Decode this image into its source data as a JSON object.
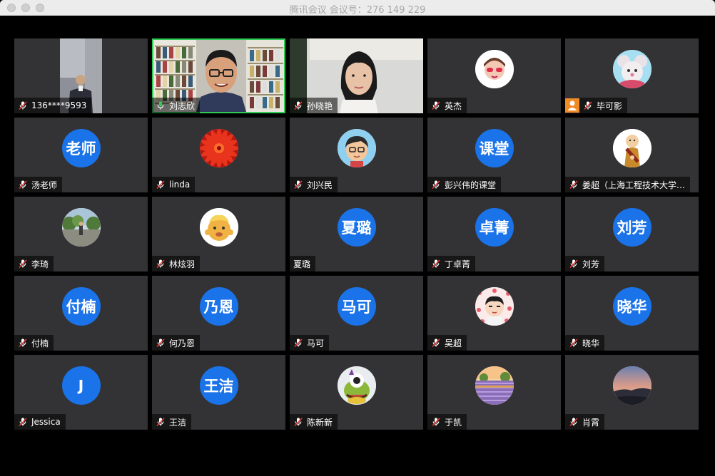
{
  "window": {
    "title": "腾讯会议 会议号：276 149 229"
  },
  "participants": [
    {
      "name": "136****9593",
      "type": "video",
      "video": "person-dark",
      "mic": "muted"
    },
    {
      "name": "刘志欣",
      "type": "video",
      "video": "man-glasses-bookshelf",
      "mic": "active",
      "speaking": true
    },
    {
      "name": "孙晓艳",
      "type": "video",
      "video": "woman",
      "mic": "muted"
    },
    {
      "name": "英杰",
      "type": "image",
      "avatar": "cartoon-girl-sunglasses",
      "mic": "muted"
    },
    {
      "name": "毕可影",
      "type": "image",
      "avatar": "cartoon-mouse",
      "mic": "muted",
      "host": true
    },
    {
      "name": "汤老师",
      "type": "text",
      "initials": "老师",
      "mic": "muted"
    },
    {
      "name": "linda",
      "type": "image",
      "avatar": "red-flower",
      "mic": "muted"
    },
    {
      "name": "刘兴民",
      "type": "image",
      "avatar": "cartoon-boy",
      "mic": "muted"
    },
    {
      "name": "彭兴伟的课堂",
      "type": "text",
      "initials": "课堂",
      "mic": "muted"
    },
    {
      "name": "姜超（上海工程技术大学…",
      "type": "image",
      "avatar": "cartoon-monk",
      "mic": "muted"
    },
    {
      "name": "李琦",
      "type": "image",
      "avatar": "outdoor-photo",
      "mic": "muted"
    },
    {
      "name": "林炫羽",
      "type": "image",
      "avatar": "cartoon-baby",
      "mic": "muted"
    },
    {
      "name": "夏璐",
      "type": "text",
      "initials": "夏璐",
      "mic": "none"
    },
    {
      "name": "丁卓菁",
      "type": "text",
      "initials": "卓菁",
      "mic": "muted"
    },
    {
      "name": "刘芳",
      "type": "text",
      "initials": "刘芳",
      "mic": "muted"
    },
    {
      "name": "付楠",
      "type": "text",
      "initials": "付楠",
      "mic": "muted"
    },
    {
      "name": "何乃恩",
      "type": "text",
      "initials": "乃恩",
      "mic": "muted"
    },
    {
      "name": "马可",
      "type": "text",
      "initials": "马可",
      "mic": "muted"
    },
    {
      "name": "吴超",
      "type": "image",
      "avatar": "cartoon-boy-hearts",
      "mic": "muted"
    },
    {
      "name": "晓华",
      "type": "text",
      "initials": "晓华",
      "mic": "muted"
    },
    {
      "name": "Jessica",
      "type": "text",
      "initials": "J",
      "mic": "muted"
    },
    {
      "name": "王洁",
      "type": "text",
      "initials": "王洁",
      "mic": "muted"
    },
    {
      "name": "陈新新",
      "type": "image",
      "avatar": "cartoon-frog",
      "mic": "muted"
    },
    {
      "name": "于凯",
      "type": "image",
      "avatar": "lavender-field",
      "mic": "muted"
    },
    {
      "name": "肖霄",
      "type": "image",
      "avatar": "sunset-landscape",
      "mic": "muted"
    }
  ],
  "colors": {
    "avatar_bg": "#1a73e8",
    "speaking": "#2ecc55",
    "tile_bg": "#333335",
    "host_badge": "#f08a24"
  }
}
